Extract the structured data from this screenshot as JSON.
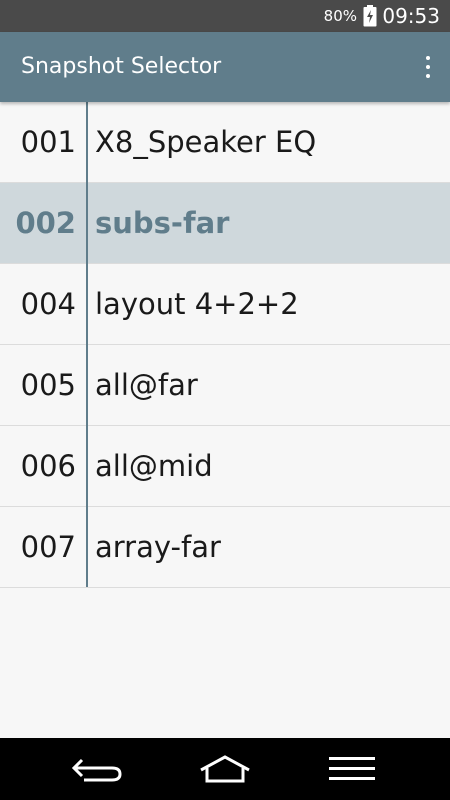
{
  "status_bar": {
    "battery_percent": "80%",
    "battery_icon": "battery-charging-icon",
    "time": "09:53"
  },
  "action_bar": {
    "title": "Snapshot Selector",
    "menu_icon": "overflow-menu-icon"
  },
  "snapshots": [
    {
      "id": "001",
      "name": "X8_Speaker EQ",
      "selected": false
    },
    {
      "id": "002",
      "name": "subs-far",
      "selected": true
    },
    {
      "id": "004",
      "name": "layout 4+2+2",
      "selected": false
    },
    {
      "id": "005",
      "name": "all@far",
      "selected": false
    },
    {
      "id": "006",
      "name": "all@mid",
      "selected": false
    },
    {
      "id": "007",
      "name": "array-far",
      "selected": false
    }
  ],
  "nav_bar": {
    "back_icon": "back-icon",
    "home_icon": "home-icon",
    "menu_icon": "menu-icon"
  },
  "colors": {
    "accent": "#607d8b",
    "selected_row": "#cfd8dc",
    "background": "#f7f7f7"
  }
}
